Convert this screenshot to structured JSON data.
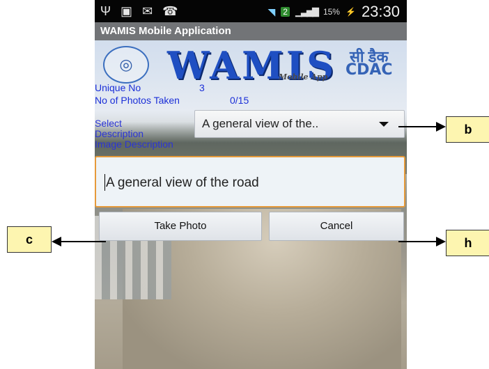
{
  "statusbar": {
    "icons_left": [
      "usb-icon",
      "image-icon",
      "mail-icon",
      "phone-call-icon"
    ],
    "wifi_icon": "wifi-icon",
    "network_badge": "2",
    "signal_icon": "signal-icon",
    "battery": "15%",
    "battery_icon": "battery-charging-icon",
    "time": "23:30"
  },
  "titlebar": {
    "title": "WAMIS Mobile Application"
  },
  "logo": {
    "wamis": "WAMIS",
    "mobile_app": "Mobile App",
    "hindi": "सी डैक",
    "cdac": "CDAC",
    "emblem_icon": "government-emblem-icon"
  },
  "info": {
    "unique_label": "Unique No",
    "unique_value": "3",
    "photos_label": "No of Photos Taken",
    "photos_value": "0/15"
  },
  "form": {
    "select_label": "Select Description",
    "image_label": "Image Description",
    "dropdown_value": "A general view of the..",
    "textbox_value": "A general view of the road",
    "take_photo": "Take Photo",
    "cancel": "Cancel"
  },
  "callouts": {
    "b": "b",
    "c": "c",
    "h": "h"
  }
}
